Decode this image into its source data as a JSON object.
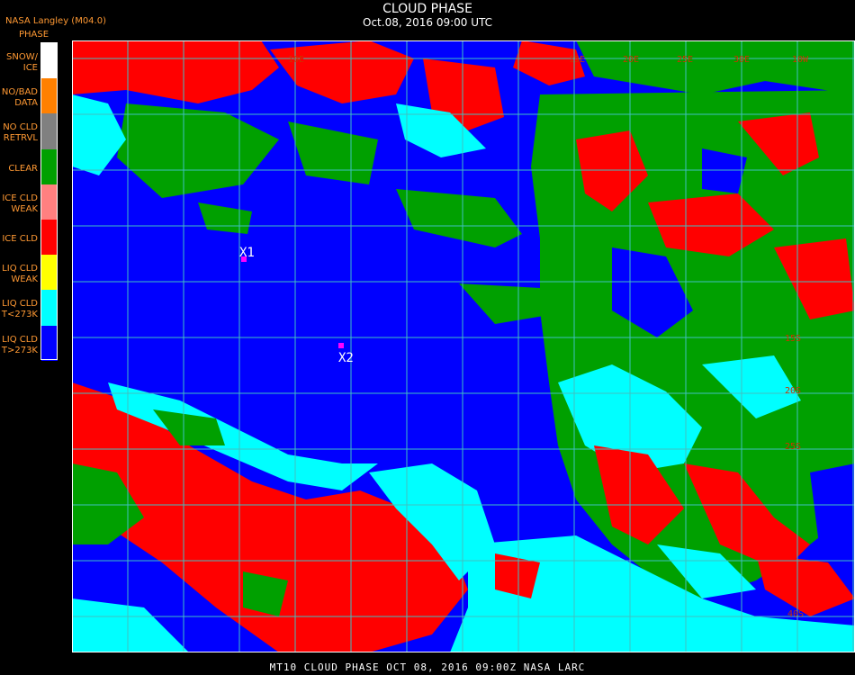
{
  "header": {
    "title": "CLOUD PHASE",
    "subtitle": "Oct.08, 2016 09:00 UTC"
  },
  "legend": {
    "source": "NASA Langley (M04.0)",
    "heading": "PHASE",
    "items": [
      {
        "line1": "SNOW/",
        "line2": "ICE",
        "color": "#ffffff"
      },
      {
        "line1": "NO/BAD",
        "line2": "DATA",
        "color": "#ff8000"
      },
      {
        "line1": "NO CLD",
        "line2": "RETRVL",
        "color": "#808080"
      },
      {
        "line1": "CLEAR",
        "line2": "",
        "color": "#00a000"
      },
      {
        "line1": "ICE CLD",
        "line2": "WEAK",
        "color": "#ff8080"
      },
      {
        "line1": "ICE CLD",
        "line2": "",
        "color": "#ff0000"
      },
      {
        "line1": "LIQ CLD",
        "line2": "WEAK",
        "color": "#ffff00"
      },
      {
        "line1": "LIQ CLD",
        "line2": "T<273K",
        "color": "#00ffff"
      },
      {
        "line1": "LIQ CLD",
        "line2": "T>273K",
        "color": "#0000ff"
      }
    ]
  },
  "map": {
    "grid_color": "#40c0c0",
    "label_color": "#cc3300",
    "longitude_labels": [
      "10E",
      "15E",
      "20E",
      "25E",
      "30E",
      "10W"
    ],
    "latitude_labels": [
      "15S",
      "20S",
      "25S",
      "40S"
    ],
    "markers": [
      {
        "label": "X1",
        "color": "#ff00ff"
      },
      {
        "label": "X2",
        "color": "#ff00ff"
      }
    ]
  },
  "footer": {
    "caption": "MT10  CLOUD PHASE   OCT 08, 2016 09:00Z   NASA LARC"
  }
}
